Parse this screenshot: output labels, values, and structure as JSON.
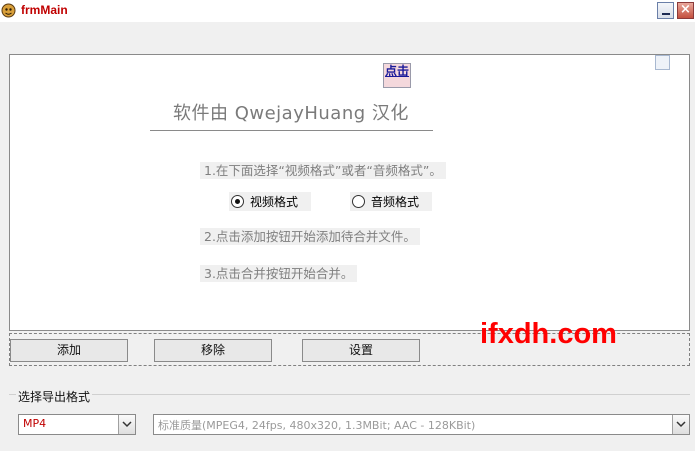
{
  "window": {
    "title": "frmMain"
  },
  "main": {
    "link_label": "点击",
    "credit": "软件由 QwejayHuang 汉化",
    "step1": "1.在下面选择“视频格式”或者“音频格式”。",
    "step2": "2.点击添加按钮开始添加待合并文件。",
    "step3": "3.点击合并按钮开始合并。",
    "radios": [
      {
        "label": "视频格式",
        "checked": true
      },
      {
        "label": "音频格式",
        "checked": false
      }
    ]
  },
  "buttons": {
    "add": "添加",
    "remove": "移除",
    "settings": "设置"
  },
  "watermark": "ifxdh.com",
  "output": {
    "group_label": "选择导出格式",
    "format_value": "MP4",
    "quality_value": "标准质量(MPEG4, 24fps, 480x320, 1.3MBit;  AAC - 128KBit)"
  },
  "colors": {
    "title": "#c00000",
    "watermark": "#ff0000",
    "format_text": "#c00000"
  }
}
